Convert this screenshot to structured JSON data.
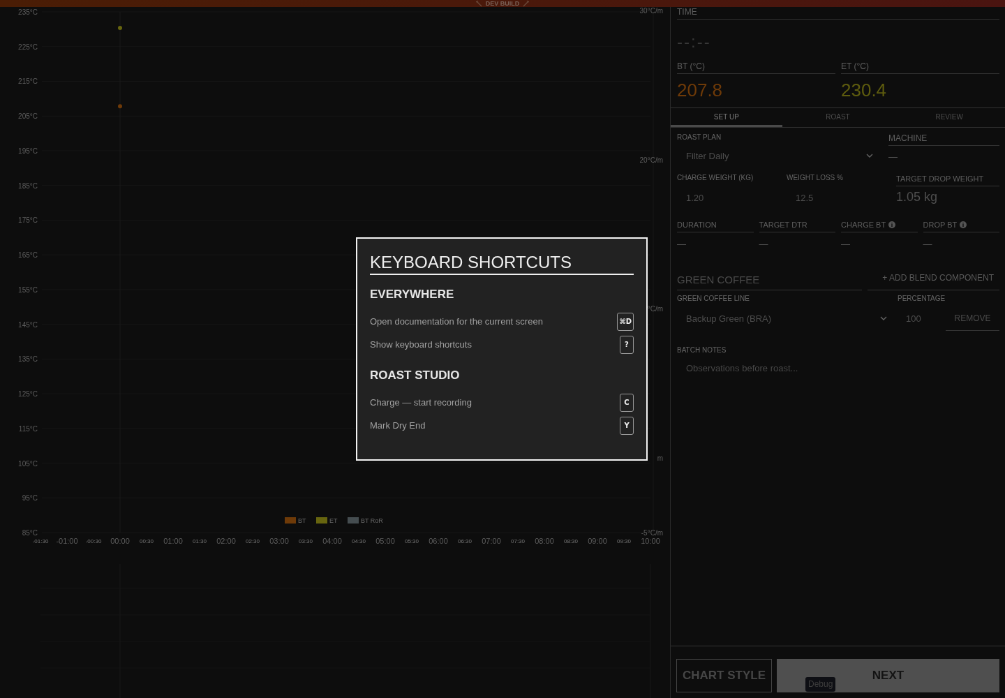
{
  "top_banner": {
    "text": "DEV BUILD"
  },
  "chart": {
    "chart_data": {
      "type": "scatter",
      "x": [
        0
      ],
      "series": [
        {
          "name": "BT",
          "color": "#6e3a08",
          "values": [
            207.8
          ]
        },
        {
          "name": "ET",
          "color": "#67650f",
          "values": [
            230.4
          ]
        },
        {
          "name": "BT RoR",
          "color": "#454d50",
          "values": [
            null
          ]
        }
      ],
      "xlim": [
        -1.5,
        10
      ],
      "ylim": [
        85,
        235
      ],
      "y2lim": [
        -5,
        30
      ],
      "grid": true,
      "legend": "bottom",
      "xticks": [
        {
          "value": -1.5,
          "label": "-01:30"
        },
        {
          "value": -1,
          "label": "-01:00"
        },
        {
          "value": -0.5,
          "label": "-00:30"
        },
        {
          "value": 0,
          "label": "00:00"
        },
        {
          "value": 0.5,
          "label": "00:30"
        },
        {
          "value": 1,
          "label": "01:00"
        },
        {
          "value": 1.5,
          "label": "01:30"
        },
        {
          "value": 2,
          "label": "02:00"
        },
        {
          "value": 2.5,
          "label": "02:30"
        },
        {
          "value": 3,
          "label": "03:00"
        },
        {
          "value": 3.5,
          "label": "03:30"
        },
        {
          "value": 4,
          "label": "04:00"
        },
        {
          "value": 4.5,
          "label": "04:30"
        },
        {
          "value": 5,
          "label": "05:00"
        },
        {
          "value": 5.5,
          "label": "05:30"
        },
        {
          "value": 6,
          "label": "06:00"
        },
        {
          "value": 6.5,
          "label": "06:30"
        },
        {
          "value": 7,
          "label": "07:00"
        },
        {
          "value": 7.5,
          "label": "07:30"
        },
        {
          "value": 8,
          "label": "08:00"
        },
        {
          "value": 8.5,
          "label": "08:30"
        },
        {
          "value": 9,
          "label": "09:00"
        },
        {
          "value": 9.5,
          "label": "09:30"
        },
        {
          "value": 10,
          "label": "10:00"
        }
      ],
      "yticks": [
        {
          "value": 235,
          "label": "235°C"
        },
        {
          "value": 225,
          "label": "225°C"
        },
        {
          "value": 215,
          "label": "215°C"
        },
        {
          "value": 205,
          "label": "205°C"
        },
        {
          "value": 195,
          "label": "195°C"
        },
        {
          "value": 185,
          "label": "185°C"
        },
        {
          "value": 175,
          "label": "175°C"
        },
        {
          "value": 165,
          "label": "165°C"
        },
        {
          "value": 155,
          "label": "155°C"
        },
        {
          "value": 145,
          "label": "145°C"
        },
        {
          "value": 135,
          "label": "135°C"
        },
        {
          "value": 125,
          "label": "125°C"
        },
        {
          "value": 115,
          "label": "115°C"
        },
        {
          "value": 105,
          "label": "105°C"
        },
        {
          "value": 95,
          "label": "95°C"
        },
        {
          "value": 85,
          "label": "85°C"
        }
      ],
      "y2ticks": [
        {
          "value": 30,
          "label": "30°C/m"
        },
        {
          "value": 20,
          "label": "20°C/m"
        },
        {
          "value": 10,
          "label": "°C/m"
        },
        {
          "value": 0,
          "label": "m"
        },
        {
          "value": -5,
          "label": "-5°C/m"
        }
      ]
    }
  },
  "readouts": [
    {
      "label": "BT (°C)",
      "value": "207.8",
      "color": "#6e3a08"
    },
    {
      "label": "ET (°C)",
      "value": "230.4",
      "color": "#5e5c0e"
    }
  ],
  "time": {
    "label": "TIME",
    "value": "--:--"
  },
  "tabs": [
    {
      "label": "SET UP",
      "selected": true
    },
    {
      "label": "ROAST",
      "selected": false
    },
    {
      "label": "REVIEW",
      "selected": false
    }
  ],
  "roast_plan": {
    "label": "ROAST PLAN",
    "value": "Filter Daily"
  },
  "machine": {
    "label": "MACHINE",
    "value": "—"
  },
  "weights": [
    {
      "kind": "input",
      "label": "CHARGE WEIGHT (KG)",
      "value": "1.20"
    },
    {
      "kind": "input",
      "label": "WEIGHT LOSS %",
      "value": "12.5"
    },
    {
      "kind": "display",
      "label": "TARGET DROP WEIGHT",
      "value": "1.05 kg"
    }
  ],
  "targets": [
    {
      "label": "DURATION",
      "value": "—",
      "info": false
    },
    {
      "label": "TARGET DTR",
      "value": "—",
      "info": false
    },
    {
      "label": "CHARGE BT",
      "value": "—",
      "info": true
    },
    {
      "label": "DROP BT",
      "value": "—",
      "info": true
    }
  ],
  "green_coffee": {
    "title": "GREEN COFFEE",
    "add_button": "+ ADD BLEND COMPONENT",
    "line_label": "GREEN COFFEE LINE",
    "percentage_label": "PERCENTAGE",
    "line_value": "Backup Green (BRA)",
    "percentage_value": "100",
    "remove_button": "REMOVE"
  },
  "batch_notes": {
    "label": "BATCH NOTES",
    "placeholder": "Observations before roast..."
  },
  "buttons": {
    "chart_style": "CHART STYLE",
    "next": "NEXT"
  },
  "debug_tooltip": "Debug",
  "modal": {
    "title": "KEYBOARD SHORTCUTS",
    "sections": [
      {
        "heading": "EVERYWHERE",
        "shortcuts": [
          {
            "action": "Open documentation for the current screen",
            "key": "⌘D"
          },
          {
            "action": "Show keyboard shortcuts",
            "key": "?"
          }
        ]
      },
      {
        "heading": "ROAST STUDIO",
        "shortcuts": [
          {
            "action": "Charge — start recording",
            "key": "C"
          },
          {
            "action": "Mark Dry End",
            "key": "Y"
          }
        ]
      }
    ]
  }
}
